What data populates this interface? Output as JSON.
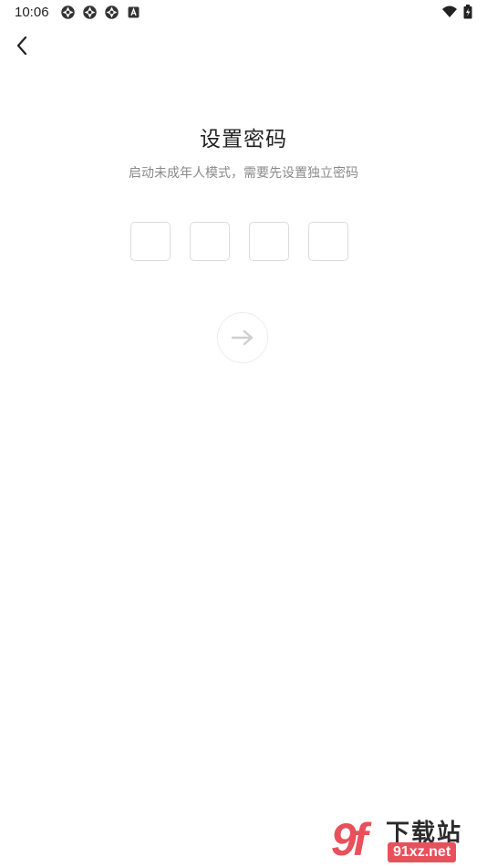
{
  "status_bar": {
    "time": "10:06",
    "left_icons": [
      "app-notification-icon",
      "app-notification-icon",
      "app-notification-icon",
      "keyboard-a-icon"
    ],
    "right_icons": [
      "wifi-icon",
      "battery-icon"
    ]
  },
  "nav": {
    "back_icon": "chevron-left-icon"
  },
  "page": {
    "title": "设置密码",
    "subtitle": "启动未成年人模式，需要先设置独立密码"
  },
  "pin": {
    "length": 4,
    "values": [
      "",
      "",
      "",
      ""
    ]
  },
  "next_button": {
    "icon": "arrow-right-icon"
  },
  "watermark": {
    "number": "9f",
    "text": "下载站",
    "url": "91xz.net",
    "brand_color": "#e8505b"
  }
}
